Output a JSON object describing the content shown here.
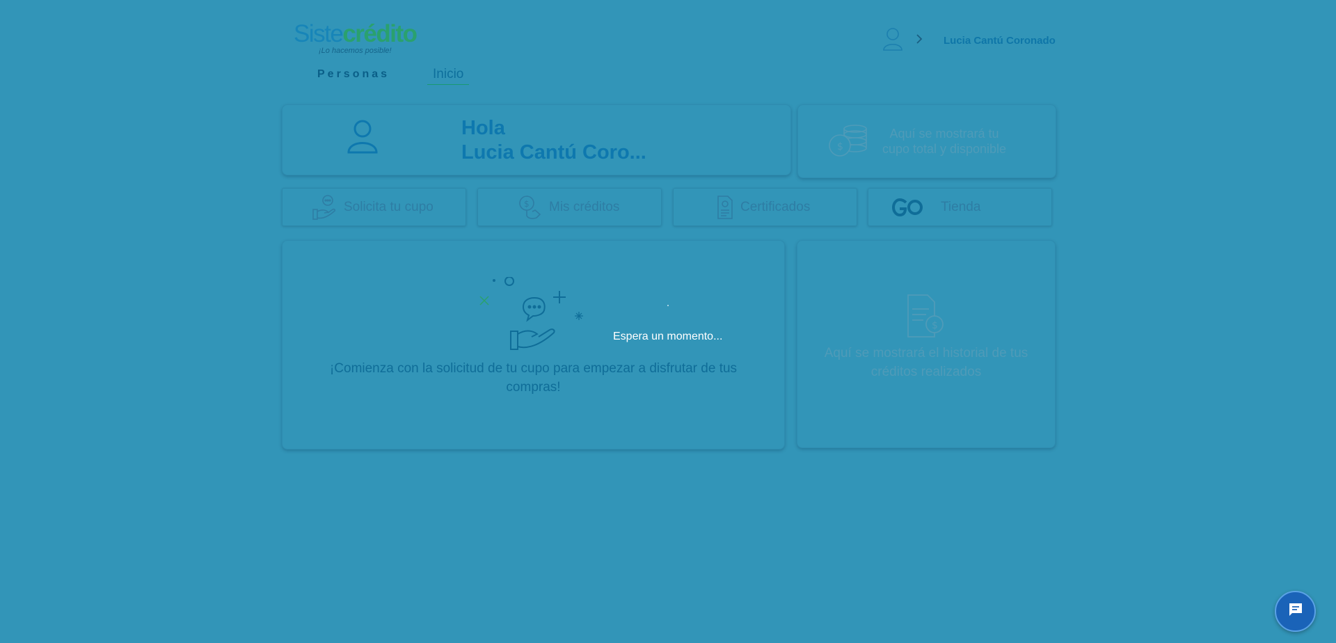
{
  "brand": {
    "logo_part1": "Siste",
    "logo_part2": "crédito",
    "tagline": "¡Lo hacemos posible!"
  },
  "header": {
    "user_name": "Lucia Cantú Coronado"
  },
  "nav": {
    "personas": "Personas",
    "inicio": "Inicio"
  },
  "greeting": {
    "hello": "Hola",
    "name": "Lucia Cantú Coro..."
  },
  "quota_card": {
    "text": "Aquí se mostrará tu cupo total y disponible"
  },
  "actions": [
    {
      "label": "Solicita tu cupo",
      "icon": "hand-chat-icon"
    },
    {
      "label": "Mis créditos",
      "icon": "coin-hand-icon"
    },
    {
      "label": "Certificados",
      "icon": "certificate-icon"
    },
    {
      "label": "Tienda",
      "icon": "go-store-icon"
    }
  ],
  "main_card": {
    "message": "¡Comienza con la solicitud de tu cupo para empezar a disfrutar de tus compras!"
  },
  "history_card": {
    "text": "Aquí se mostrará el historial de tus créditos realizados"
  },
  "loader": {
    "text": "Espera un momento..."
  },
  "colors": {
    "overlay_background": "#3295b8",
    "primary_blue": "#1785b8",
    "brand_green": "#2aa16e",
    "chat_button": "#1a63b8"
  }
}
